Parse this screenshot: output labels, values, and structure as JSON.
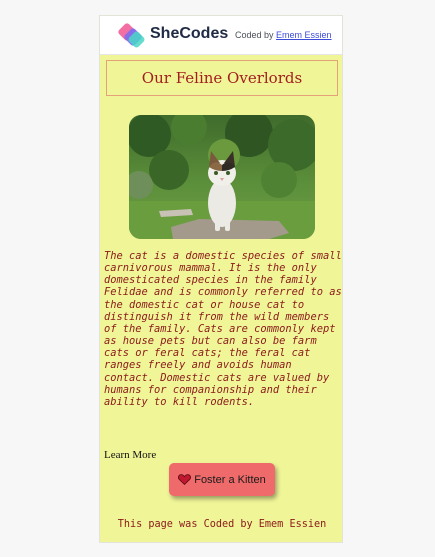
{
  "header": {
    "logo_text": "SheCodes",
    "coded_by_prefix": "Coded by ",
    "coded_by_name": "Emem Essien"
  },
  "main": {
    "title": "Our Feline Overlords",
    "description": "The cat is a domestic species of small carnivorous mammal. It is the only domesticated species in the family Felidae and is commonly referred to as the domestic cat or house cat to distinguish it from the wild members of the family. Cats are commonly kept as house pets but can also be farm cats or feral cats; the feral cat ranges freely and avoids human contact. Domestic cats are valued by humans for companionship and their ability to kill rodents.",
    "learn_more": "Learn More",
    "foster_button": "Foster a Kitten"
  },
  "footer": {
    "text": "This page was Coded by Emem Essien"
  },
  "colors": {
    "card_bg": "#f0f598",
    "accent_text": "#8b1a1a",
    "button_bg": "#ef6a6a",
    "title_border": "#e5a17a"
  },
  "icons": {
    "logo": "shecodes-logo-icon",
    "button": "heart-icon",
    "photo": "cat-photo"
  }
}
